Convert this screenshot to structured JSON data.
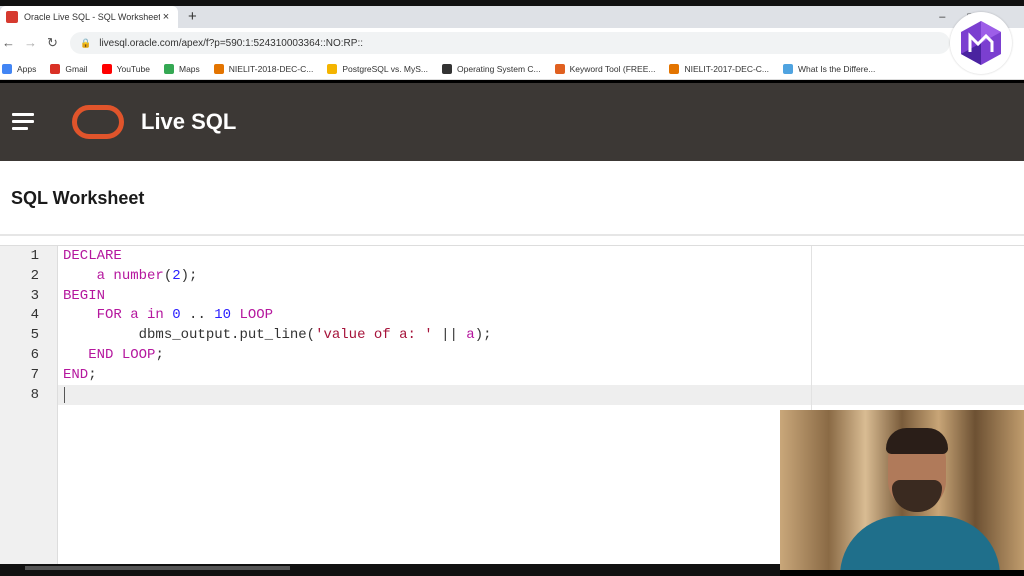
{
  "browser": {
    "tab_title": "Oracle Live SQL - SQL Worksheet",
    "tab_close": "×",
    "new_tab": "+",
    "minimize": "–",
    "maximize": "□",
    "url": "livesql.oracle.com/apex/f?p=590:1:524310003364::NO:RP::",
    "bookmarks": [
      {
        "label": "Apps",
        "color": "#4285f4"
      },
      {
        "label": "Gmail",
        "color": "#d93025"
      },
      {
        "label": "YouTube",
        "color": "#ff0000"
      },
      {
        "label": "Maps",
        "color": "#34a853"
      },
      {
        "label": "NIELIT-2018-DEC-C...",
        "color": "#e37400"
      },
      {
        "label": "PostgreSQL vs. MyS...",
        "color": "#f4b400"
      },
      {
        "label": "Operating System C...",
        "color": "#333333"
      },
      {
        "label": "Keyword Tool (FREE...",
        "color": "#e06020"
      },
      {
        "label": "NIELIT-2017-DEC-C...",
        "color": "#e37400"
      },
      {
        "label": "What Is the Differe...",
        "color": "#4fa3e0"
      }
    ]
  },
  "app": {
    "title": "Live SQL",
    "accent": "#e0542b",
    "header_bg": "#3c3835"
  },
  "page": {
    "title": "SQL Worksheet"
  },
  "editor": {
    "line_numbers": [
      "1",
      "2",
      "3",
      "4",
      "5",
      "6",
      "7",
      "8"
    ],
    "code": {
      "l1_kw": "DECLARE",
      "l2_indent": "    ",
      "l2_ident": "a ",
      "l2_type": "number",
      "l2_open": "(",
      "l2_num": "2",
      "l2_close": ");",
      "l3_kw": "BEGIN",
      "l4_indent": "    ",
      "l4_kw1": "FOR ",
      "l4_ident": "a ",
      "l4_kw2": "in ",
      "l4_num1": "0",
      "l4_dots": " .. ",
      "l4_num2": "10",
      "l4_kw3": " LOOP",
      "l5_indent": "         ",
      "l5_call": "dbms_output.put_line(",
      "l5_str": "'value of a: '",
      "l5_concat": " || ",
      "l5_var": "a",
      "l5_end": ");",
      "l6_indent": "   ",
      "l6_kw": "END LOOP",
      "l6_end": ";",
      "l7_kw": "END",
      "l7_end": ";"
    }
  }
}
